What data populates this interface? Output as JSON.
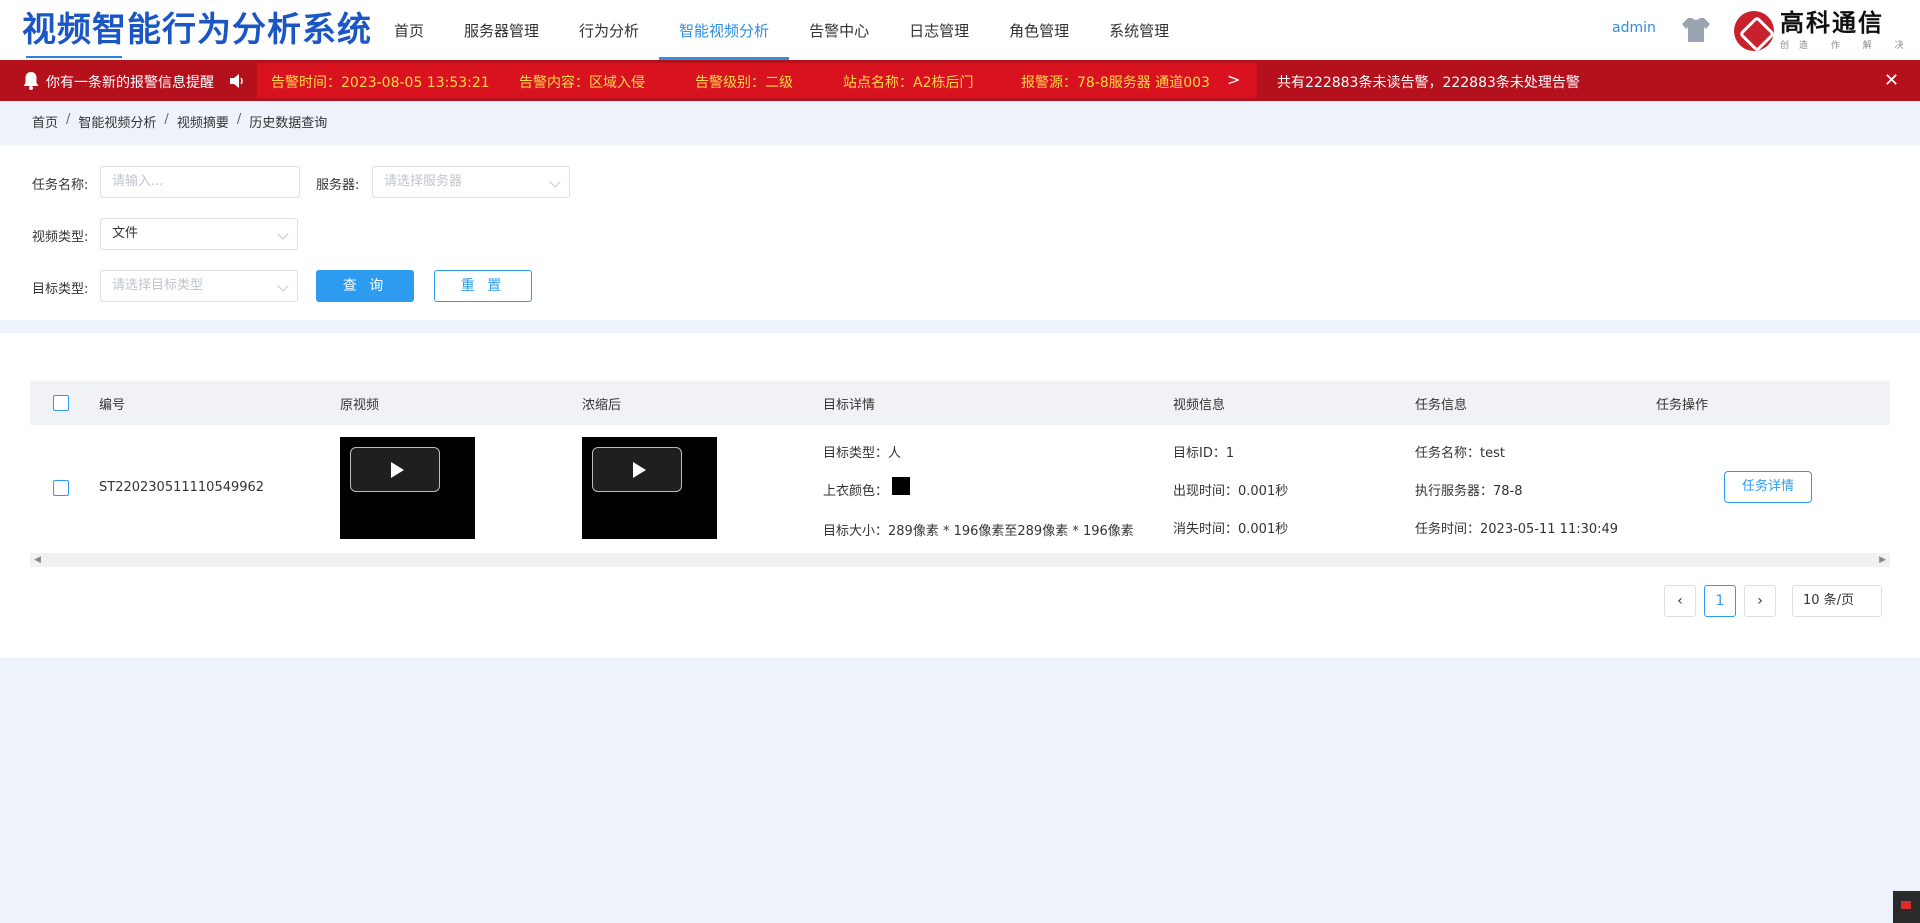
{
  "header": {
    "title": "视频智能行为分析系统",
    "nav": [
      "首页",
      "服务器管理",
      "行为分析",
      "智能视频分析",
      "告警中心",
      "日志管理",
      "角色管理",
      "系统管理"
    ],
    "active_nav": "智能视频分析",
    "user": "admin",
    "brand_name": "高科通信",
    "brand_sub": "创造 作 解 决"
  },
  "alarm": {
    "title": "你有一条新的报警信息提醒",
    "time": "告警时间：2023-08-05 13:53:21",
    "content": "告警内容：区域入侵",
    "level": "告警级别：二级",
    "site": "站点名称：A2栋后门",
    "source": "报警源：78-8服务器 通道003",
    "summary": "共有222883条未读告警，222883条未处理告警",
    "accent_color": "#b5111d"
  },
  "breadcrumb": [
    "首页",
    "智能视频分析",
    "视频摘要",
    "历史数据查询"
  ],
  "filters": {
    "task_name_label": "任务名称:",
    "task_name_placeholder": "请输入...",
    "server_label": "服务器:",
    "server_placeholder": "请选择服务器",
    "video_type_label": "视频类型:",
    "video_type_value": "文件",
    "target_type_label": "目标类型:",
    "target_type_placeholder": "请选择目标类型",
    "query_button": "查 询",
    "reset_button": "重 置"
  },
  "table": {
    "columns": [
      "编号",
      "原视频",
      "浓缩后",
      "目标详情",
      "视频信息",
      "任务信息",
      "任务操作"
    ],
    "rows": [
      {
        "id": "ST220230511110549962",
        "target_type": "目标类型：人",
        "upper_color_label": "上衣颜色：",
        "target_size": "目标大小：289像素 * 196像素至289像素 * 196像素",
        "target_id": "目标ID：1",
        "appear_time": "出现时间：0.001秒",
        "disappear_time": "消失时间：0.001秒",
        "task_name": "任务名称：test",
        "exec_server": "执行服务器：78-8",
        "task_time": "任务时间：2023-05-11 11:30:49",
        "action": "任务详情"
      }
    ]
  },
  "pagination": {
    "current_page": "1",
    "page_size": "10 条/页"
  }
}
